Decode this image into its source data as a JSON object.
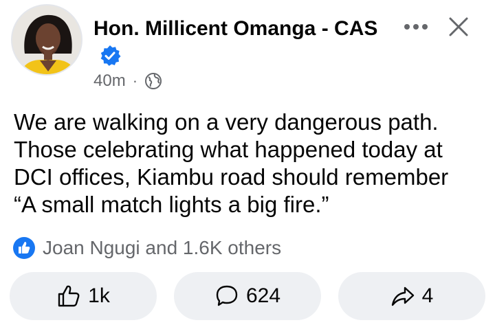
{
  "post": {
    "author": {
      "name": "Hon. Millicent Omanga - CAS",
      "verified": true
    },
    "timestamp": "40m",
    "separator": "·",
    "audience_icon": "globe-icon",
    "text": "We are walking on a very dangerous path.\nThose celebrating what happened today at\nDCI offices, Kiambu road should remember\n“A small match lights a big fire.”"
  },
  "reactions": {
    "icon": "like-icon",
    "summary": "Joan Ngugi and 1.6K others"
  },
  "actions": {
    "like": {
      "icon": "thumbs-up-icon",
      "count": "1k"
    },
    "comment": {
      "icon": "comment-icon",
      "count": "624"
    },
    "share": {
      "icon": "share-icon",
      "count": "4"
    }
  },
  "colors": {
    "accent": "#1877f2",
    "muted_text": "#65676b",
    "button_bg": "#eef0f3"
  }
}
